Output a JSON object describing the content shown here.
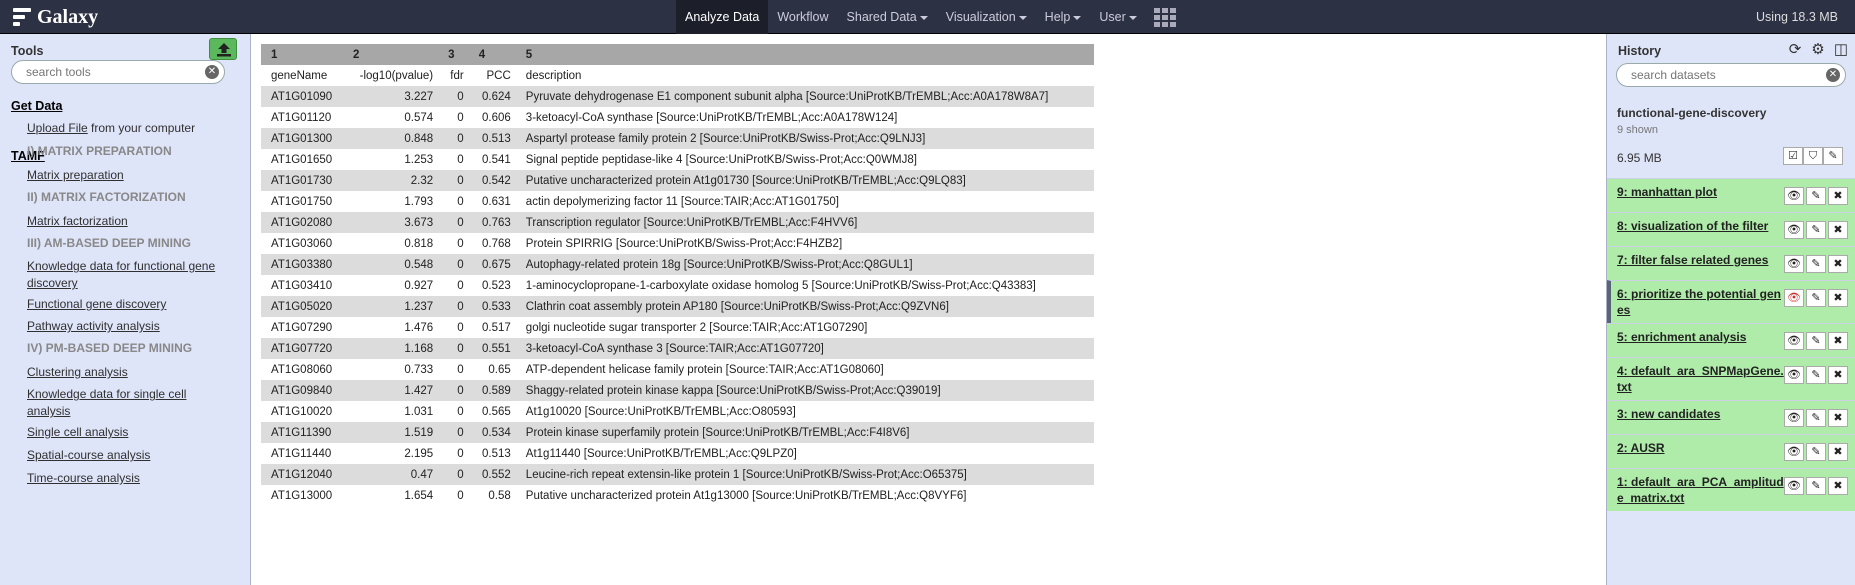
{
  "masthead": {
    "brand": "Galaxy",
    "nav": [
      {
        "label": "Analyze Data",
        "caret": false,
        "active": true
      },
      {
        "label": "Workflow",
        "caret": false
      },
      {
        "label": "Shared Data",
        "caret": true
      },
      {
        "label": "Visualization",
        "caret": true
      },
      {
        "label": "Help",
        "caret": true
      },
      {
        "label": "User",
        "caret": true
      }
    ],
    "quota": "Using 18.3 MB"
  },
  "tools": {
    "title": "Tools",
    "search_placeholder": "search tools",
    "get_data": "Get Data",
    "upload_link": "Upload File",
    "upload_suffix": " from your computer",
    "tamf": "TAMF",
    "items": [
      {
        "kind": "label",
        "text": "I) MATRIX PREPARATION"
      },
      {
        "kind": "link",
        "text": "Matrix preparation"
      },
      {
        "kind": "label",
        "text": "II) MATRIX FACTORIZATION"
      },
      {
        "kind": "link",
        "text": "Matrix factorization"
      },
      {
        "kind": "label",
        "text": "III) AM-BASED DEEP MINING"
      },
      {
        "kind": "link",
        "text": "Knowledge data for functional gene discovery"
      },
      {
        "kind": "link",
        "text": "Functional gene discovery"
      },
      {
        "kind": "link",
        "text": "Pathway activity analysis"
      },
      {
        "kind": "label",
        "text": "IV) PM-BASED DEEP MINING"
      },
      {
        "kind": "link",
        "text": "Clustering analysis"
      },
      {
        "kind": "link",
        "text": "Knowledge data for single cell analysis"
      },
      {
        "kind": "link",
        "text": "Single cell analysis"
      },
      {
        "kind": "link",
        "text": "Spatial-course analysis"
      },
      {
        "kind": "link",
        "text": "Time-course analysis"
      }
    ]
  },
  "table": {
    "indexes": [
      "1",
      "2",
      "3",
      "4",
      "5"
    ],
    "headers": [
      "geneName",
      "-log10(pvalue)",
      "fdr",
      "PCC",
      "description"
    ],
    "rows": [
      [
        "AT1G01090",
        "3.227",
        "0",
        "0.624",
        "Pyruvate dehydrogenase E1 component subunit alpha [Source:UniProtKB/TrEMBL;Acc:A0A178W8A7]"
      ],
      [
        "AT1G01120",
        "0.574",
        "0",
        "0.606",
        "3-ketoacyl-CoA synthase [Source:UniProtKB/TrEMBL;Acc:A0A178W124]"
      ],
      [
        "AT1G01300",
        "0.848",
        "0",
        "0.513",
        "Aspartyl protease family protein 2 [Source:UniProtKB/Swiss-Prot;Acc:Q9LNJ3]"
      ],
      [
        "AT1G01650",
        "1.253",
        "0",
        "0.541",
        "Signal peptide peptidase-like 4 [Source:UniProtKB/Swiss-Prot;Acc:Q0WMJ8]"
      ],
      [
        "AT1G01730",
        "2.32",
        "0",
        "0.542",
        "Putative uncharacterized protein At1g01730 [Source:UniProtKB/TrEMBL;Acc:Q9LQ83]"
      ],
      [
        "AT1G01750",
        "1.793",
        "0",
        "0.631",
        "actin depolymerizing factor 11 [Source:TAIR;Acc:AT1G01750]"
      ],
      [
        "AT1G02080",
        "3.673",
        "0",
        "0.763",
        "Transcription regulator [Source:UniProtKB/TrEMBL;Acc:F4HVV6]"
      ],
      [
        "AT1G03060",
        "0.818",
        "0",
        "0.768",
        "Protein SPIRRIG [Source:UniProtKB/Swiss-Prot;Acc:F4HZB2]"
      ],
      [
        "AT1G03380",
        "0.548",
        "0",
        "0.675",
        "Autophagy-related protein 18g [Source:UniProtKB/Swiss-Prot;Acc:Q8GUL1]"
      ],
      [
        "AT1G03410",
        "0.927",
        "0",
        "0.523",
        "1-aminocyclopropane-1-carboxylate oxidase homolog 5 [Source:UniProtKB/Swiss-Prot;Acc:Q43383]"
      ],
      [
        "AT1G05020",
        "1.237",
        "0",
        "0.533",
        "Clathrin coat assembly protein AP180 [Source:UniProtKB/Swiss-Prot;Acc:Q9ZVN6]"
      ],
      [
        "AT1G07290",
        "1.476",
        "0",
        "0.517",
        "golgi nucleotide sugar transporter 2 [Source:TAIR;Acc:AT1G07290]"
      ],
      [
        "AT1G07720",
        "1.168",
        "0",
        "0.551",
        "3-ketoacyl-CoA synthase 3 [Source:TAIR;Acc:AT1G07720]"
      ],
      [
        "AT1G08060",
        "0.733",
        "0",
        "0.65",
        "ATP-dependent helicase family protein [Source:TAIR;Acc:AT1G08060]"
      ],
      [
        "AT1G09840",
        "1.427",
        "0",
        "0.589",
        "Shaggy-related protein kinase kappa [Source:UniProtKB/Swiss-Prot;Acc:Q39019]"
      ],
      [
        "AT1G10020",
        "1.031",
        "0",
        "0.565",
        "At1g10020 [Source:UniProtKB/TrEMBL;Acc:O80593]"
      ],
      [
        "AT1G11390",
        "1.519",
        "0",
        "0.534",
        "Protein kinase superfamily protein [Source:UniProtKB/TrEMBL;Acc:F4I8V6]"
      ],
      [
        "AT1G11440",
        "2.195",
        "0",
        "0.513",
        "At1g11440 [Source:UniProtKB/TrEMBL;Acc:Q9LPZ0]"
      ],
      [
        "AT1G12040",
        "0.47",
        "0",
        "0.552",
        "Leucine-rich repeat extensin-like protein 1 [Source:UniProtKB/Swiss-Prot;Acc:O65375]"
      ],
      [
        "AT1G13000",
        "1.654",
        "0",
        "0.58",
        "Putative uncharacterized protein At1g13000 [Source:UniProtKB/TrEMBL;Acc:Q8VYF6]"
      ]
    ]
  },
  "history": {
    "title": "History",
    "search_placeholder": "search datasets",
    "name": "functional-gene-discovery",
    "shown": "9 shown",
    "size": "6.95 MB",
    "datasets": [
      {
        "title": "9: manhattan plot",
        "highlight": false
      },
      {
        "title": "8: visualization of the filter",
        "highlight": false
      },
      {
        "title": "7: filter false related genes",
        "highlight": false
      },
      {
        "title": "6: prioritize the potential genes",
        "highlight": true
      },
      {
        "title": "5: enrichment analysis",
        "highlight": false
      },
      {
        "title": "4: default_ara_SNPMapGene.txt",
        "highlight": false
      },
      {
        "title": "3: new candidates",
        "highlight": false
      },
      {
        "title": "2: AUSR",
        "highlight": false
      },
      {
        "title": "1: default_ara_PCA_amplitude_matrix.txt",
        "highlight": false
      }
    ]
  },
  "colors": {
    "masthead": "#2c3143",
    "panel": "#dfe5f9",
    "dataset_ok": "#afeca9",
    "upload": "#5cb85c"
  }
}
